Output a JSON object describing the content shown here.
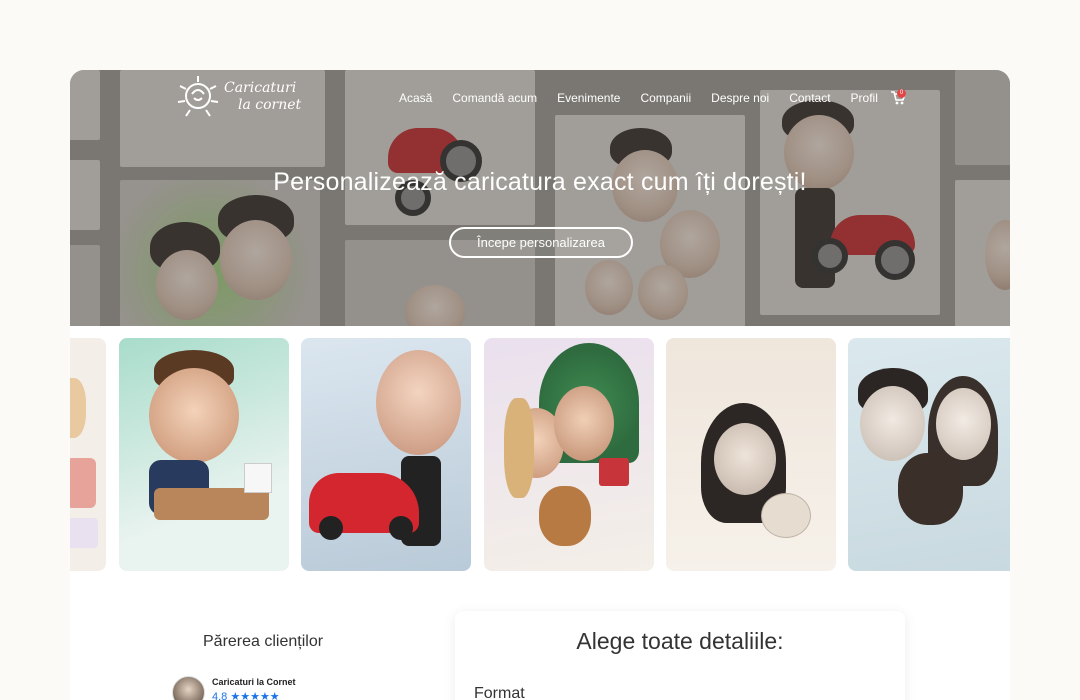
{
  "brand": {
    "name_line1": "Caricaturi",
    "name_line2": "la cornet"
  },
  "nav": {
    "items": [
      "Acasă",
      "Comandă acum",
      "Evenimente",
      "Companii",
      "Despre noi",
      "Contact",
      "Profil"
    ],
    "cart_count": "0"
  },
  "hero": {
    "title": "Personalizează caricatura exact cum îți dorești!",
    "button_label": "Începe personalizarea"
  },
  "reviews": {
    "title": "Părerea clienților",
    "business_name": "Caricaturi la Cornet",
    "rating": "4.8",
    "stars": "★★★★★"
  },
  "details": {
    "title": "Alege toate detaliile:",
    "format_label": "Format"
  },
  "colors": {
    "background": "#fbfaf6",
    "badge": "#e24545",
    "rating_blue": "#1a73e8"
  }
}
